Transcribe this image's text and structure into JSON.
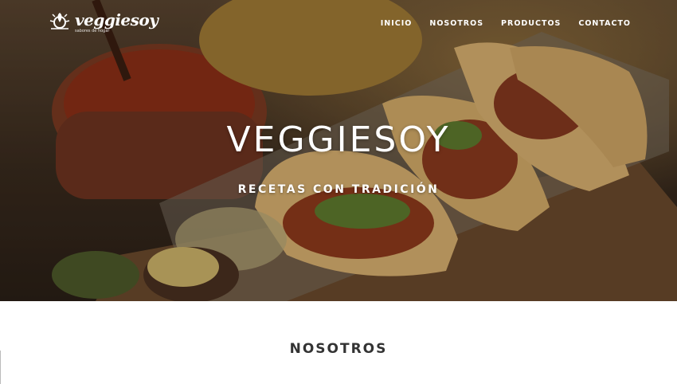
{
  "brand": {
    "name": "veggiesoy",
    "tagline": "sabores de hogar"
  },
  "nav": {
    "items": [
      "INICIO",
      "NOSOTROS",
      "PRODUCTOS",
      "CONTACTO"
    ]
  },
  "hero": {
    "title": "VEGGIESOY",
    "subtitle": "RECETAS CON TRADICIÓN"
  },
  "sections": {
    "about_title": "NOSOTROS"
  },
  "colors": {
    "nav_text": "#ffffff",
    "section_title": "#333333",
    "page_bg": "#ffffff"
  },
  "icons": {
    "logo": "sun-leaf-logo-icon"
  }
}
